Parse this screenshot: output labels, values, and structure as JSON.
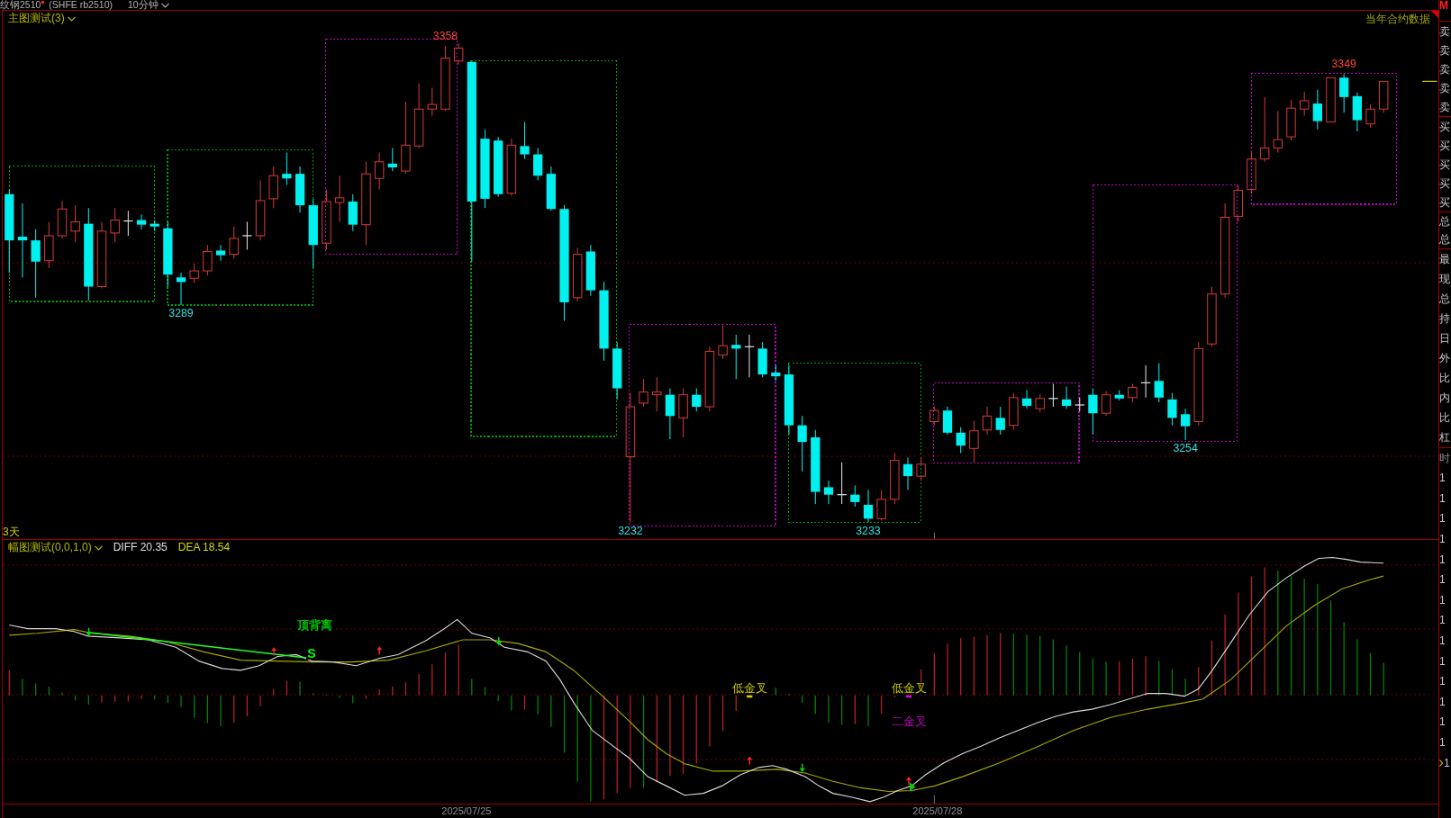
{
  "title_bar": {
    "symbol": "纹钢2510",
    "contract": "(SHFE rb2510)",
    "period": "10分钟"
  },
  "main_chart": {
    "indicator": "主图测试(3)",
    "corner_label": "当年合约数据",
    "range_label": "3天",
    "zones": [
      {
        "color": "#00a000"
      },
      {
        "color": "#00a000"
      },
      {
        "color": "#c000c0"
      },
      {
        "color": "#00a000"
      },
      {
        "color": "#c000c0"
      },
      {
        "color": "#00a000"
      },
      {
        "color": "#c000c0"
      },
      {
        "color": "#c000c0"
      },
      {
        "color": "#c000c0"
      }
    ],
    "price_marks": [
      {
        "text": "3289",
        "kind": "low"
      },
      {
        "text": "3358",
        "kind": "high"
      },
      {
        "text": "3232",
        "kind": "low"
      },
      {
        "text": "3233",
        "kind": "low"
      },
      {
        "text": "3254",
        "kind": "low"
      },
      {
        "text": "3349",
        "kind": "high"
      }
    ]
  },
  "sub_chart": {
    "indicator": "幅图测试(0,0,1,0)",
    "readings": [
      {
        "text": "DIFF 20.35",
        "color": "#e0e0e0"
      },
      {
        "text": "DEA 18.54",
        "color": "#d8d800"
      }
    ],
    "signals": [
      {
        "text": "顶背离",
        "color": "#00c000"
      },
      {
        "text": "S",
        "color": "#00ff00"
      },
      {
        "text": "低金叉",
        "color": "#c8c800"
      },
      {
        "text": "低金叉",
        "color": "#c8c800"
      },
      {
        "text": "二金叉",
        "color": "#c000c0"
      }
    ]
  },
  "time_axis": {
    "labels": [
      "2025/07/25",
      "2025/07/28"
    ]
  },
  "side_panel": {
    "tab": "M",
    "groups": [
      {
        "labels": [
          "卖",
          "卖",
          "卖",
          "卖",
          "卖"
        ]
      },
      {
        "labels": [
          "买",
          "买",
          "买",
          "买",
          "买"
        ]
      },
      {
        "labels": [
          "总",
          "总"
        ]
      },
      {
        "labels": [
          "最",
          "现",
          "总",
          "持",
          "日",
          "外",
          "比",
          "内",
          "比",
          "杠"
        ]
      }
    ],
    "time_header": "时",
    "time_rows": [
      {
        "text": "1",
        "current": false
      },
      {
        "text": "1",
        "current": false
      },
      {
        "text": "1",
        "current": false
      },
      {
        "text": "1",
        "current": false
      },
      {
        "text": "1",
        "current": false
      },
      {
        "text": "1",
        "current": false
      },
      {
        "text": "1",
        "current": false
      },
      {
        "text": "1",
        "current": false
      },
      {
        "text": "1",
        "current": false
      },
      {
        "text": "1",
        "current": false
      },
      {
        "text": "1",
        "current": false
      },
      {
        "text": "1",
        "current": false
      },
      {
        "text": "1",
        "current": false
      },
      {
        "text": "1",
        "current": false
      },
      {
        "text": "1",
        "current": true
      }
    ]
  }
}
